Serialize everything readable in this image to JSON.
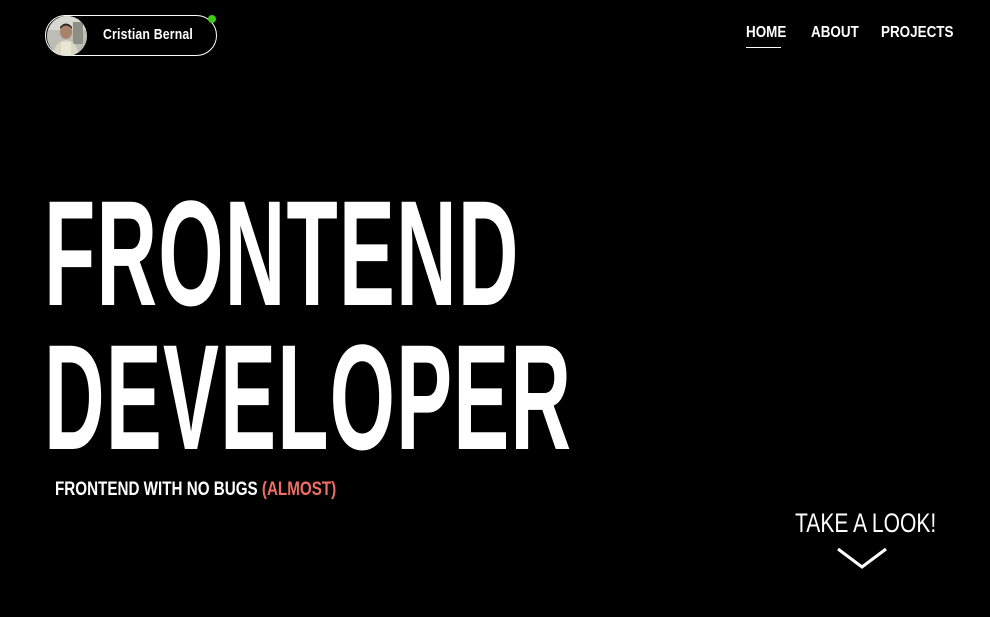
{
  "profile": {
    "name": "Cristian Bernal",
    "status": "online",
    "status_color": "#43c918"
  },
  "nav": {
    "items": [
      {
        "label": "HOME",
        "active": true
      },
      {
        "label": "ABOUT",
        "active": false
      },
      {
        "label": "PROJECTS",
        "active": false
      }
    ]
  },
  "hero": {
    "line1": "FRONTEND",
    "line2": "DEVELOPER",
    "tagline_main": "FRONTEND WITH NO BUGS",
    "tagline_accent": "(ALMOST)"
  },
  "cta": {
    "label": "TAKE A LOOK!",
    "icon": "chevron-down-icon"
  },
  "colors": {
    "background": "#000000",
    "text": "#ffffff",
    "accent": "#ee6e66"
  }
}
